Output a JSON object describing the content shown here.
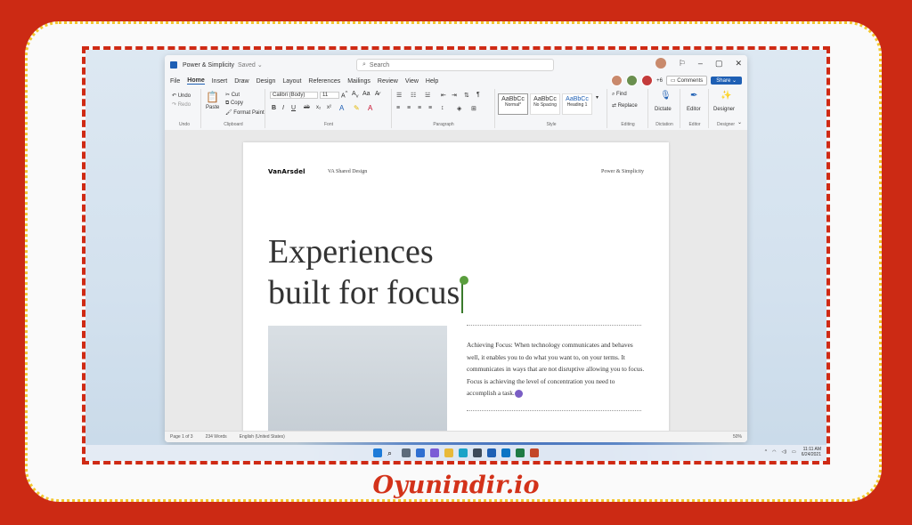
{
  "window": {
    "doc_title": "Power & Simplicity",
    "saved_status": "Saved",
    "search_placeholder": "Search"
  },
  "menu": {
    "tabs": [
      "File",
      "Home",
      "Insert",
      "Draw",
      "Design",
      "Layout",
      "References",
      "Mailings",
      "Review",
      "View",
      "Help"
    ],
    "presence_more": "+6",
    "comments_label": "Comments",
    "share_label": "Share"
  },
  "ribbon": {
    "undo": "Undo",
    "redo": "Redo",
    "undo_group": "Undo",
    "paste": "Paste",
    "cut": "Cut",
    "copy": "Copy",
    "format_painter": "Format Paint",
    "clipboard_group": "Clipboard",
    "font_name": "Calibri (Body)",
    "font_size": "11",
    "font_group": "Font",
    "paragraph_group": "Paragraph",
    "styles": [
      {
        "sample": "AaBbCc",
        "name": "Normal*"
      },
      {
        "sample": "AaBbCc",
        "name": "No Spacing"
      },
      {
        "sample": "AaBbCc",
        "name": "Heading 1"
      }
    ],
    "style_group": "Style",
    "find": "Find",
    "replace": "Replace",
    "editing_group": "Editing",
    "dictate": "Dictate",
    "dictation_group": "Dictation",
    "editor": "Editor",
    "editor_group": "Editor",
    "designer": "Designer",
    "designer_group": "Designer"
  },
  "document": {
    "header_logo": "VanArsdel",
    "header_mid": "VA Shared Design",
    "header_right": "Power & Simplicity",
    "headline_line1": "Experiences",
    "headline_line2": "built for focus",
    "body": "Achieving Focus: When technology communicates and behaves well, it enables you to do what you want to, on your terms. It communicates in ways that are not disruptive allowing you to focus. Focus is achieving the level of concentration you need to accomplish a task."
  },
  "status": {
    "page": "Page 1 of 3",
    "words": "234 Words",
    "language": "English (United States)",
    "zoom": "50%"
  },
  "taskbar": {
    "time": "11:11 AM",
    "date": "6/24/2021"
  },
  "watermark": "Oyunindir.io",
  "colors": {
    "background": "#cc2a14",
    "word_blue": "#1e5fb4",
    "dashed_border": "#cf2a14",
    "dotted_border": "#f3c62d"
  }
}
